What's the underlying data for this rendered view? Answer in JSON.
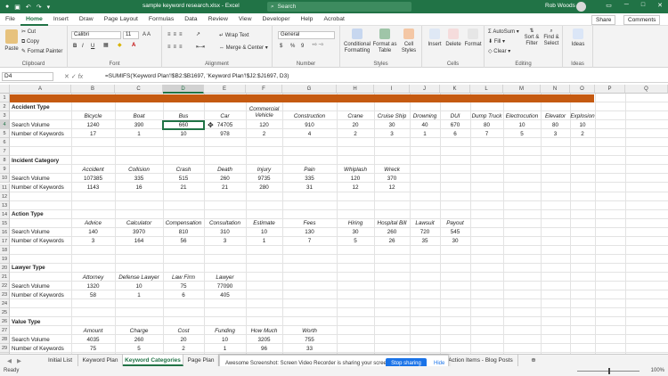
{
  "window": {
    "title": "sample keyword research.xlsx - Excel",
    "search_placeholder": "Search",
    "user": "Rob Woods",
    "controls": [
      "─",
      "▭",
      "□",
      "✕"
    ]
  },
  "menu": {
    "tabs": [
      "File",
      "Home",
      "Insert",
      "Draw",
      "Page Layout",
      "Formulas",
      "Data",
      "Review",
      "View",
      "Developer",
      "Help",
      "Acrobat"
    ],
    "active_tab": "Home",
    "share": "Share",
    "comments": "Comments"
  },
  "ribbon": {
    "clipboard": {
      "label": "Clipboard",
      "paste": "Paste",
      "cut": "Cut",
      "copy": "Copy",
      "format_painter": "Format Painter"
    },
    "font": {
      "label": "Font",
      "name": "Calibri",
      "size": "11",
      "bold": "B",
      "italic": "I",
      "underline": "U"
    },
    "alignment": {
      "label": "Alignment",
      "wrap": "Wrap Text",
      "merge": "Merge & Center"
    },
    "number": {
      "label": "Number",
      "format": "General",
      "currency": "$",
      "percent": "%",
      "comma": "9"
    },
    "styles": {
      "label": "Styles",
      "conditional": "Conditional Formatting",
      "format_table": "Format as Table",
      "cell_styles": "Cell Styles"
    },
    "cells": {
      "label": "Cells",
      "insert": "Insert",
      "delete": "Delete",
      "format": "Format"
    },
    "editing": {
      "label": "Editing",
      "autosum": "AutoSum",
      "fill": "Fill",
      "clear": "Clear",
      "sort": "Sort & Filter",
      "find": "Find & Select"
    },
    "ideas": {
      "label": "Ideas",
      "ideas": "Ideas"
    }
  },
  "formula_bar": {
    "name_box": "D4",
    "fx": "fx",
    "formula": "=SUMIFS('Keyword Plan'!$B2:$B1697, 'Keyword Plan'!$J2:$J1697, D3)"
  },
  "columns": [
    "A",
    "B",
    "C",
    "D",
    "E",
    "F",
    "G",
    "H",
    "I",
    "J",
    "K",
    "L",
    "M",
    "N",
    "O",
    "P",
    "Q"
  ],
  "selected_column": "D",
  "selected_row": "4",
  "rows": [
    {
      "n": "1"
    },
    {
      "n": "2",
      "A": "Accident Type",
      "A_bold": true
    },
    {
      "n": "3",
      "cats": [
        "Bicycle",
        "Boat",
        "Bus",
        "Car",
        "Commercial Vehicle",
        "Construction",
        "Crane",
        "Cruise Ship",
        "Drowning",
        "DUI",
        "Dump Truck",
        "Electrocution",
        "Elevator",
        "Explosion"
      ]
    },
    {
      "n": "4",
      "A": "Search Volume",
      "vals": [
        "1240",
        "390",
        "660",
        "74705",
        "120",
        "910",
        "20",
        "30",
        "40",
        "670",
        "80",
        "10",
        "80",
        "10"
      ]
    },
    {
      "n": "5",
      "A": "Number of Keywords",
      "vals": [
        "17",
        "1",
        "10",
        "978",
        "2",
        "4",
        "2",
        "3",
        "1",
        "6",
        "7",
        "5",
        "3",
        "2"
      ]
    },
    {
      "n": "6"
    },
    {
      "n": "7"
    },
    {
      "n": "8",
      "A": "Incident Category",
      "A_bold": true
    },
    {
      "n": "9",
      "cats": [
        "Accident",
        "Collision",
        "Crash",
        "Death",
        "Injury",
        "Pain",
        "Whiplash",
        "Wreck"
      ]
    },
    {
      "n": "10",
      "A": "Search Volume",
      "vals": [
        "107385",
        "335",
        "515",
        "260",
        "9735",
        "335",
        "120",
        "370"
      ]
    },
    {
      "n": "11",
      "A": "Number of Keywords",
      "vals": [
        "1143",
        "16",
        "21",
        "21",
        "280",
        "31",
        "12",
        "12"
      ]
    },
    {
      "n": "12"
    },
    {
      "n": "13"
    },
    {
      "n": "14",
      "A": "Action Type",
      "A_bold": true
    },
    {
      "n": "15",
      "cats": [
        "Advice",
        "Calculator",
        "Compensation",
        "Consultation",
        "Estimate",
        "Fees",
        "Hiring",
        "Hospital Bill",
        "Lawsuit",
        "Payout"
      ]
    },
    {
      "n": "16",
      "A": "Search Volume",
      "vals": [
        "140",
        "3970",
        "810",
        "310",
        "10",
        "130",
        "30",
        "260",
        "720",
        "545"
      ]
    },
    {
      "n": "17",
      "A": "Number of Keywords",
      "vals": [
        "3",
        "164",
        "56",
        "3",
        "1",
        "7",
        "5",
        "26",
        "35",
        "30"
      ]
    },
    {
      "n": "18"
    },
    {
      "n": "19"
    },
    {
      "n": "20",
      "A": "Lawyer Type",
      "A_bold": true
    },
    {
      "n": "21",
      "cats": [
        "Attorney",
        "Defense Lawyer",
        "Law Firm",
        "Lawyer"
      ]
    },
    {
      "n": "22",
      "A": "Search Volume",
      "vals": [
        "1320",
        "10",
        "75",
        "77090"
      ]
    },
    {
      "n": "23",
      "A": "Number of Keywords",
      "vals": [
        "58",
        "1",
        "6",
        "405"
      ]
    },
    {
      "n": "24"
    },
    {
      "n": "25"
    },
    {
      "n": "26",
      "A": "Value Type",
      "A_bold": true
    },
    {
      "n": "27",
      "cats": [
        "Amount",
        "Charge",
        "Cost",
        "Funding",
        "How Much",
        "Worth"
      ]
    },
    {
      "n": "28",
      "A": "Search Volume",
      "vals": [
        "4035",
        "260",
        "20",
        "10",
        "3205",
        "755"
      ]
    },
    {
      "n": "29",
      "A": "Number of Keywords",
      "vals": [
        "75",
        "5",
        "2",
        "1",
        "96",
        "33"
      ]
    },
    {
      "n": "30"
    }
  ],
  "sheet_tabs": [
    "Initial List",
    "Keyword Plan",
    "Keyword Categories",
    "Page Plan",
    "Action Items - Blog Posts"
  ],
  "active_sheet": "Keyword Categories",
  "notification": {
    "message": "Awesome Screenshot: Screen Video Recorder is sharing your screen.",
    "stop": "Stop sharing",
    "hide": "Hide"
  },
  "status": {
    "ready": "Ready",
    "zoom": "100%"
  },
  "colors": {
    "excel_green": "#217346",
    "banner_orange": "#c55a11",
    "share_blue": "#1a73e8"
  }
}
